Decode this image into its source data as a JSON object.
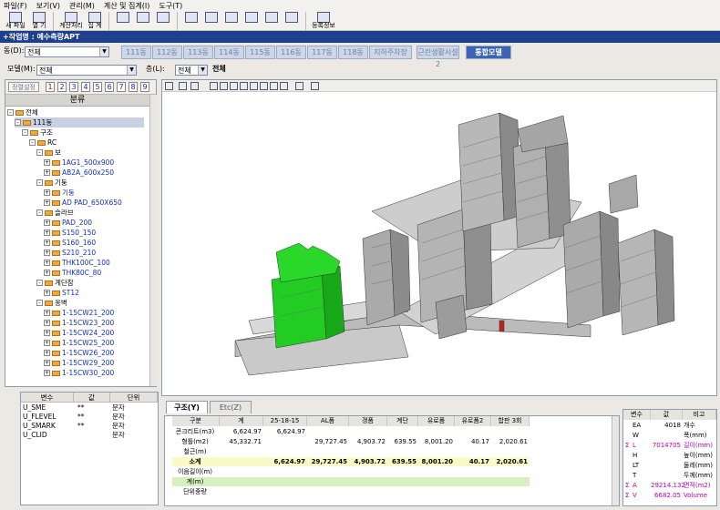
{
  "menu": [
    "파일(F)",
    "보기(V)",
    "관리(M)",
    "계산 및 집계(I)",
    "도구(T)"
  ],
  "toolbar": {
    "new_file": "새 파일",
    "open": "열 기",
    "calc": "계산처리",
    "total": "집 계",
    "reg_info": "등록정보"
  },
  "title_bar": "+작업명 : 예수측량APT",
  "building_label": "동(D):",
  "building_value": "전체",
  "building_tabs": [
    "111동",
    "112동",
    "113동",
    "114동",
    "115동",
    "116동",
    "117동",
    "118동",
    "지하주차장",
    "근린생활시설2",
    "통합모델"
  ],
  "active_tab": "통합모델",
  "model_label": "모델(M):",
  "model_value": "전체",
  "floor_label": "층(L):",
  "floor_value": "전체",
  "floor_extra": "전체",
  "left_panel": {
    "recalc_label": "정렬설정",
    "numbers": [
      "1",
      "2",
      "3",
      "4",
      "5",
      "6",
      "7",
      "8",
      "9"
    ],
    "header": "분류",
    "tree": [
      {
        "t": "전체",
        "l": 0,
        "b": "-"
      },
      {
        "t": "111동",
        "l": 1,
        "b": "-",
        "sel": true
      },
      {
        "t": "구조",
        "l": 2,
        "b": "-"
      },
      {
        "t": "RC",
        "l": 3,
        "b": "-"
      },
      {
        "t": "보",
        "l": 4,
        "b": "-"
      },
      {
        "t": "1AG1_500x900",
        "l": 5,
        "b": "+",
        "blue": true
      },
      {
        "t": "AB2A_600x250",
        "l": 5,
        "b": "+",
        "blue": true
      },
      {
        "t": "기둥",
        "l": 4,
        "b": "-"
      },
      {
        "t": "기둥",
        "l": 5,
        "b": "+",
        "blue": true
      },
      {
        "t": "AD PAD_650X650",
        "l": 5,
        "b": "+",
        "blue": true
      },
      {
        "t": "슬라브",
        "l": 4,
        "b": "-"
      },
      {
        "t": "PAD_200",
        "l": 5,
        "b": "+",
        "blue": true
      },
      {
        "t": "S150_150",
        "l": 5,
        "b": "+",
        "blue": true
      },
      {
        "t": "S160_160",
        "l": 5,
        "b": "+",
        "blue": true
      },
      {
        "t": "S210_210",
        "l": 5,
        "b": "+",
        "blue": true
      },
      {
        "t": "THK100C_100",
        "l": 5,
        "b": "+",
        "blue": true
      },
      {
        "t": "THK80C_80",
        "l": 5,
        "b": "+",
        "blue": true
      },
      {
        "t": "계단참",
        "l": 4,
        "b": "-"
      },
      {
        "t": "ST12",
        "l": 5,
        "b": "+",
        "blue": true
      },
      {
        "t": "옹벽",
        "l": 4,
        "b": "-"
      },
      {
        "t": "1-15CW21_200",
        "l": 5,
        "b": "+",
        "blue": true
      },
      {
        "t": "1-15CW23_200",
        "l": 5,
        "b": "+",
        "blue": true
      },
      {
        "t": "1-15CW24_200",
        "l": 5,
        "b": "+",
        "blue": true
      },
      {
        "t": "1-15CW25_200",
        "l": 5,
        "b": "+",
        "blue": true
      },
      {
        "t": "1-15CW26_200",
        "l": 5,
        "b": "+",
        "blue": true
      },
      {
        "t": "1-15CW29_200",
        "l": 5,
        "b": "+",
        "blue": true
      },
      {
        "t": "1-15CW30_200",
        "l": 5,
        "b": "+",
        "blue": true
      }
    ]
  },
  "var_table": {
    "headers": [
      "변수",
      "값",
      "단위"
    ],
    "rows": [
      [
        "U_SME",
        "**",
        "문자"
      ],
      [
        "U_FLEVEL",
        "**",
        "문자"
      ],
      [
        "U_SMARK",
        "**",
        "문자"
      ],
      [
        "U_CLID",
        "",
        "문자"
      ]
    ]
  },
  "bottom_tabs": [
    "구조(Y)",
    "Etc(Z)"
  ],
  "grid": {
    "headers": [
      "구분",
      "계",
      "25-18-15",
      "AL폼",
      "갱폼",
      "계단",
      "유로폼",
      "유로폼2",
      "합판 3회"
    ],
    "rows": [
      [
        "콘크리트(m3)",
        "6,624.97",
        "6,624.97",
        "",
        "",
        "",
        "",
        "",
        ""
      ],
      [
        "형틀(m2)",
        "45,332.71",
        "",
        "29,727.45",
        "4,903.72",
        "639.55",
        "8,001.20",
        "40.17",
        "2,020.61"
      ],
      [
        "철근(m)",
        "",
        "",
        "",
        "",
        "",
        "",
        "",
        ""
      ],
      [
        "소계",
        "",
        "6,624.97",
        "29,727.45",
        "4,903.72",
        "639.55",
        "8,001.20",
        "40.17",
        "2,020.61"
      ],
      [
        "이음길이(m)",
        "",
        "",
        "",
        "",
        "",
        "",
        "",
        ""
      ],
      [
        "계(m)",
        "",
        "",
        "",
        "",
        "",
        "",
        "",
        ""
      ],
      [
        "단위중량",
        "",
        "",
        "",
        "",
        "",
        "",
        "",
        ""
      ]
    ]
  },
  "props": {
    "headers": [
      "변수",
      "값",
      "비고"
    ],
    "rows": [
      [
        "",
        "EA",
        "4018",
        "개수",
        false
      ],
      [
        "",
        "W",
        "",
        "폭(mm)",
        false
      ],
      [
        "Σ",
        "L",
        "7014705",
        "길이(mm)",
        true
      ],
      [
        "",
        "H",
        "",
        "높이(mm)",
        false
      ],
      [
        "",
        "LT",
        "",
        "둘레(mm)",
        false
      ],
      [
        "",
        "T",
        "",
        "두께(mm)",
        false
      ],
      [
        "Σ",
        "A",
        "29214.132",
        "면적(m2)",
        true
      ],
      [
        "Σ",
        "V",
        "6682.05",
        "Volume",
        true
      ]
    ]
  }
}
